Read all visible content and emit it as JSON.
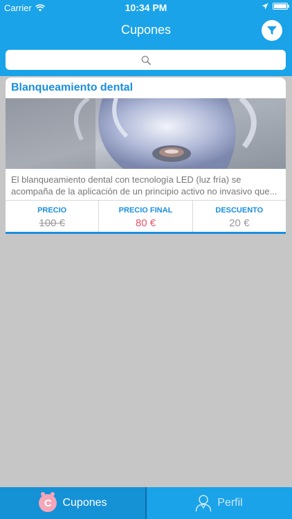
{
  "status_bar": {
    "carrier": "Carrier",
    "time": "10:34 PM"
  },
  "nav": {
    "title": "Cupones",
    "filter_icon": "funnel-icon"
  },
  "search": {
    "placeholder": "",
    "icon": "search-icon"
  },
  "coupons": [
    {
      "title": "Blanqueamiento dental",
      "description_line1": "El blanqueamiento dental con tecnología LED (luz fría) se",
      "description_line2": "acompaña de la aplicación de un principio activo no invasivo que...",
      "price_label": "PRECIO",
      "price_value": "100 €",
      "final_label": "PRECIO FINAL",
      "final_value": "80 €",
      "discount_label": "DESCUENTO",
      "discount_value": "20 €"
    }
  ],
  "tabs": [
    {
      "label": "Cupones",
      "icon": "coupon-icon",
      "active": true
    },
    {
      "label": "Perfil",
      "icon": "profile-icon",
      "active": false
    }
  ],
  "colors": {
    "primary": "#1aa3e8",
    "accent_text": "#1a8fe0",
    "final_price": "#e8556a",
    "background": "#c6c6c6"
  }
}
